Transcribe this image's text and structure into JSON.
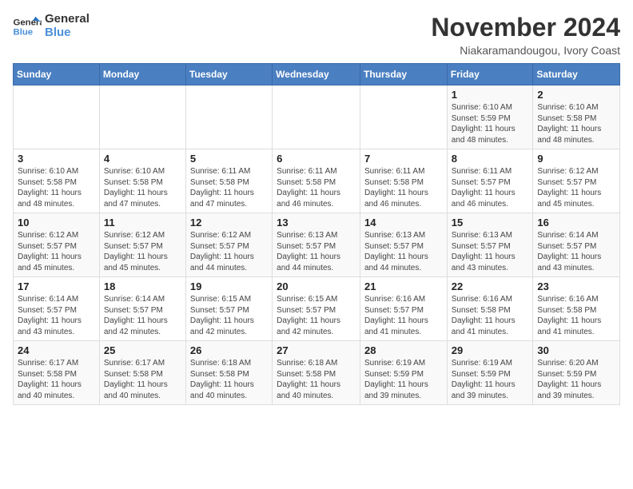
{
  "logo": {
    "line1": "General",
    "line2": "Blue"
  },
  "title": "November 2024",
  "location": "Niakaramandougou, Ivory Coast",
  "weekdays": [
    "Sunday",
    "Monday",
    "Tuesday",
    "Wednesday",
    "Thursday",
    "Friday",
    "Saturday"
  ],
  "weeks": [
    [
      {
        "day": "",
        "info": ""
      },
      {
        "day": "",
        "info": ""
      },
      {
        "day": "",
        "info": ""
      },
      {
        "day": "",
        "info": ""
      },
      {
        "day": "",
        "info": ""
      },
      {
        "day": "1",
        "info": "Sunrise: 6:10 AM\nSunset: 5:59 PM\nDaylight: 11 hours and 48 minutes."
      },
      {
        "day": "2",
        "info": "Sunrise: 6:10 AM\nSunset: 5:58 PM\nDaylight: 11 hours and 48 minutes."
      }
    ],
    [
      {
        "day": "3",
        "info": "Sunrise: 6:10 AM\nSunset: 5:58 PM\nDaylight: 11 hours and 48 minutes."
      },
      {
        "day": "4",
        "info": "Sunrise: 6:10 AM\nSunset: 5:58 PM\nDaylight: 11 hours and 47 minutes."
      },
      {
        "day": "5",
        "info": "Sunrise: 6:11 AM\nSunset: 5:58 PM\nDaylight: 11 hours and 47 minutes."
      },
      {
        "day": "6",
        "info": "Sunrise: 6:11 AM\nSunset: 5:58 PM\nDaylight: 11 hours and 46 minutes."
      },
      {
        "day": "7",
        "info": "Sunrise: 6:11 AM\nSunset: 5:58 PM\nDaylight: 11 hours and 46 minutes."
      },
      {
        "day": "8",
        "info": "Sunrise: 6:11 AM\nSunset: 5:57 PM\nDaylight: 11 hours and 46 minutes."
      },
      {
        "day": "9",
        "info": "Sunrise: 6:12 AM\nSunset: 5:57 PM\nDaylight: 11 hours and 45 minutes."
      }
    ],
    [
      {
        "day": "10",
        "info": "Sunrise: 6:12 AM\nSunset: 5:57 PM\nDaylight: 11 hours and 45 minutes."
      },
      {
        "day": "11",
        "info": "Sunrise: 6:12 AM\nSunset: 5:57 PM\nDaylight: 11 hours and 45 minutes."
      },
      {
        "day": "12",
        "info": "Sunrise: 6:12 AM\nSunset: 5:57 PM\nDaylight: 11 hours and 44 minutes."
      },
      {
        "day": "13",
        "info": "Sunrise: 6:13 AM\nSunset: 5:57 PM\nDaylight: 11 hours and 44 minutes."
      },
      {
        "day": "14",
        "info": "Sunrise: 6:13 AM\nSunset: 5:57 PM\nDaylight: 11 hours and 44 minutes."
      },
      {
        "day": "15",
        "info": "Sunrise: 6:13 AM\nSunset: 5:57 PM\nDaylight: 11 hours and 43 minutes."
      },
      {
        "day": "16",
        "info": "Sunrise: 6:14 AM\nSunset: 5:57 PM\nDaylight: 11 hours and 43 minutes."
      }
    ],
    [
      {
        "day": "17",
        "info": "Sunrise: 6:14 AM\nSunset: 5:57 PM\nDaylight: 11 hours and 43 minutes."
      },
      {
        "day": "18",
        "info": "Sunrise: 6:14 AM\nSunset: 5:57 PM\nDaylight: 11 hours and 42 minutes."
      },
      {
        "day": "19",
        "info": "Sunrise: 6:15 AM\nSunset: 5:57 PM\nDaylight: 11 hours and 42 minutes."
      },
      {
        "day": "20",
        "info": "Sunrise: 6:15 AM\nSunset: 5:57 PM\nDaylight: 11 hours and 42 minutes."
      },
      {
        "day": "21",
        "info": "Sunrise: 6:16 AM\nSunset: 5:57 PM\nDaylight: 11 hours and 41 minutes."
      },
      {
        "day": "22",
        "info": "Sunrise: 6:16 AM\nSunset: 5:58 PM\nDaylight: 11 hours and 41 minutes."
      },
      {
        "day": "23",
        "info": "Sunrise: 6:16 AM\nSunset: 5:58 PM\nDaylight: 11 hours and 41 minutes."
      }
    ],
    [
      {
        "day": "24",
        "info": "Sunrise: 6:17 AM\nSunset: 5:58 PM\nDaylight: 11 hours and 40 minutes."
      },
      {
        "day": "25",
        "info": "Sunrise: 6:17 AM\nSunset: 5:58 PM\nDaylight: 11 hours and 40 minutes."
      },
      {
        "day": "26",
        "info": "Sunrise: 6:18 AM\nSunset: 5:58 PM\nDaylight: 11 hours and 40 minutes."
      },
      {
        "day": "27",
        "info": "Sunrise: 6:18 AM\nSunset: 5:58 PM\nDaylight: 11 hours and 40 minutes."
      },
      {
        "day": "28",
        "info": "Sunrise: 6:19 AM\nSunset: 5:59 PM\nDaylight: 11 hours and 39 minutes."
      },
      {
        "day": "29",
        "info": "Sunrise: 6:19 AM\nSunset: 5:59 PM\nDaylight: 11 hours and 39 minutes."
      },
      {
        "day": "30",
        "info": "Sunrise: 6:20 AM\nSunset: 5:59 PM\nDaylight: 11 hours and 39 minutes."
      }
    ]
  ]
}
